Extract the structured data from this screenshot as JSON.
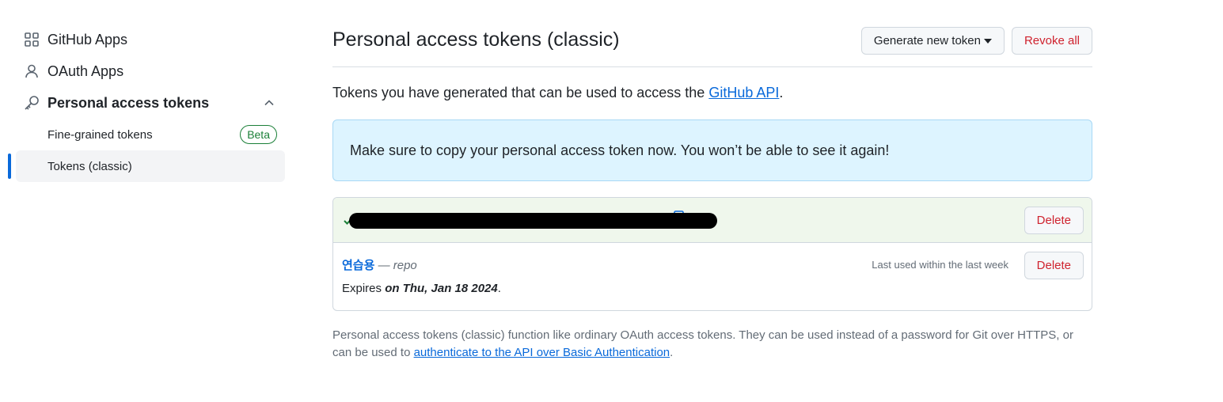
{
  "sidebar": {
    "items": [
      {
        "label": "GitHub Apps",
        "icon": "apps-grid-icon"
      },
      {
        "label": "OAuth Apps",
        "icon": "person-icon"
      },
      {
        "label": "Personal access tokens",
        "icon": "key-icon"
      }
    ],
    "sub_items": [
      {
        "label": "Fine-grained tokens",
        "badge": "Beta"
      },
      {
        "label": "Tokens (classic)"
      }
    ]
  },
  "main": {
    "title": "Personal access tokens (classic)",
    "generate_label": "Generate new token",
    "revoke_label": "Revoke all",
    "intro_prefix": "Tokens you have generated that can be used to access the ",
    "intro_link": "GitHub API",
    "intro_suffix": ".",
    "flash": "Make sure to copy your personal access token now. You won’t be able to see it again!",
    "new_token_delete": "Delete",
    "token": {
      "name": "연습용",
      "scope_sep": " — ",
      "scope": "repo",
      "last_used": "Last used within the last week",
      "delete": "Delete",
      "expires_prefix": "Expires ",
      "expires_date": "on Thu, Jan 18 2024",
      "expires_suffix": "."
    },
    "footnote_text": "Personal access tokens (classic) function like ordinary OAuth access tokens. They can be used instead of a password for Git over HTTPS, or can be used to ",
    "footnote_link": "authenticate to the API over Basic Authentication",
    "footnote_suffix": "."
  },
  "colors": {
    "accent": "#0969da",
    "danger": "#cf222e",
    "success": "#1a7f37",
    "flash_bg": "#ddf4ff",
    "new_token_bg": "#eff7ec"
  }
}
